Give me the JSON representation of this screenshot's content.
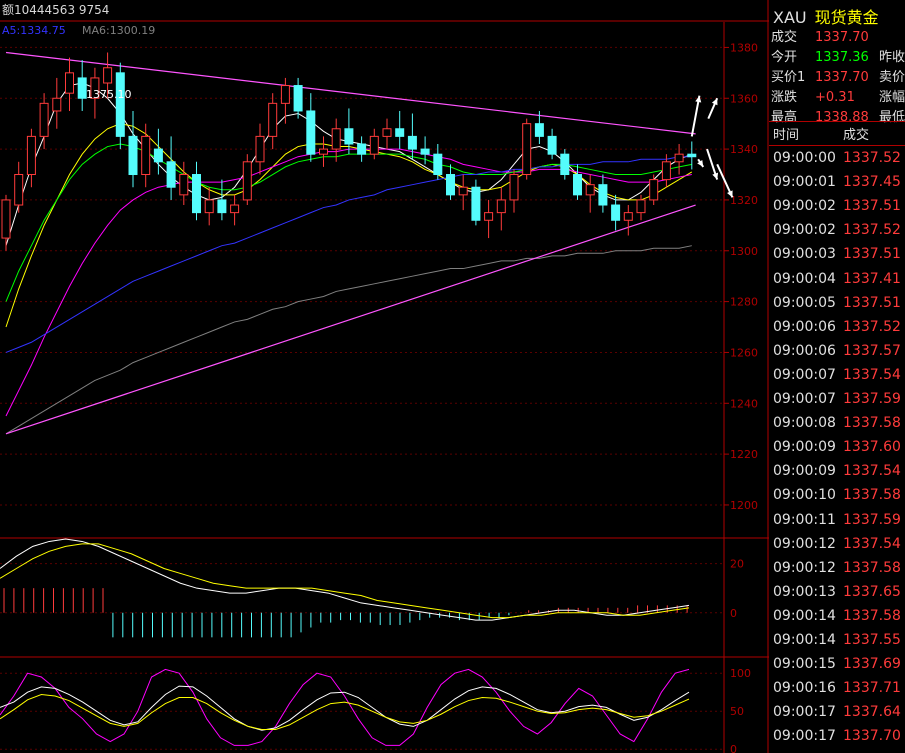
{
  "header": {
    "volume_text": "额10444563 9754",
    "ma5_label": "A5:1334.75",
    "ma6_label": "MA6:1300.19"
  },
  "colors": {
    "up": "#ff3b3b",
    "down": "#54fcfc",
    "border": "#b00000",
    "ma_white": "#ffffff",
    "ma_yellow": "#ffff00",
    "ma_magenta": "#ff00ff",
    "ma_green": "#00ff00",
    "ma_blue": "#3333ff",
    "ma_gray": "#808080",
    "trend": "#ff55ff",
    "arrow": "#ffffff"
  },
  "icons": [
    "up-arrow-icon",
    "down-arrow-icon"
  ],
  "chart_data": [
    {
      "type": "candlestick",
      "peak_label": "1375.10",
      "y_ticks": [
        1200,
        1220,
        1240,
        1260,
        1280,
        1300,
        1320,
        1340,
        1360,
        1380
      ],
      "ylim": [
        1187,
        1390
      ],
      "candles": [
        [
          1305,
          1322,
          1300,
          1320
        ],
        [
          1318,
          1335,
          1315,
          1330
        ],
        [
          1330,
          1348,
          1325,
          1345
        ],
        [
          1345,
          1362,
          1340,
          1358
        ],
        [
          1355,
          1368,
          1348,
          1360
        ],
        [
          1362,
          1376,
          1355,
          1370
        ],
        [
          1368,
          1375,
          1355,
          1360
        ],
        [
          1360,
          1372,
          1352,
          1368
        ],
        [
          1366,
          1378,
          1360,
          1372
        ],
        [
          1370,
          1374,
          1340,
          1345
        ],
        [
          1345,
          1355,
          1325,
          1330
        ],
        [
          1330,
          1350,
          1325,
          1345
        ],
        [
          1340,
          1348,
          1330,
          1335
        ],
        [
          1335,
          1345,
          1320,
          1325
        ],
        [
          1322,
          1335,
          1318,
          1330
        ],
        [
          1330,
          1335,
          1312,
          1315
        ],
        [
          1315,
          1325,
          1310,
          1320
        ],
        [
          1320,
          1328,
          1312,
          1315
        ],
        [
          1315,
          1322,
          1310,
          1318
        ],
        [
          1320,
          1338,
          1318,
          1335
        ],
        [
          1335,
          1350,
          1330,
          1345
        ],
        [
          1345,
          1362,
          1340,
          1358
        ],
        [
          1358,
          1368,
          1350,
          1365
        ],
        [
          1365,
          1368,
          1352,
          1355
        ],
        [
          1355,
          1362,
          1335,
          1338
        ],
        [
          1338,
          1345,
          1333,
          1340
        ],
        [
          1340,
          1352,
          1335,
          1348
        ],
        [
          1348,
          1356,
          1338,
          1342
        ],
        [
          1342,
          1345,
          1335,
          1338
        ],
        [
          1338,
          1348,
          1336,
          1345
        ],
        [
          1345,
          1352,
          1340,
          1348
        ],
        [
          1348,
          1355,
          1340,
          1345
        ],
        [
          1345,
          1354,
          1336,
          1340
        ],
        [
          1340,
          1345,
          1334,
          1338
        ],
        [
          1338,
          1342,
          1328,
          1330
        ],
        [
          1330,
          1334,
          1320,
          1322
        ],
        [
          1322,
          1330,
          1316,
          1325
        ],
        [
          1325,
          1328,
          1310,
          1312
        ],
        [
          1312,
          1320,
          1305,
          1315
        ],
        [
          1315,
          1325,
          1308,
          1320
        ],
        [
          1320,
          1332,
          1315,
          1330
        ],
        [
          1330,
          1352,
          1328,
          1350
        ],
        [
          1350,
          1355,
          1342,
          1345
        ],
        [
          1345,
          1348,
          1336,
          1338
        ],
        [
          1338,
          1340,
          1328,
          1330
        ],
        [
          1330,
          1334,
          1320,
          1322
        ],
        [
          1322,
          1330,
          1315,
          1326
        ],
        [
          1326,
          1330,
          1315,
          1318
        ],
        [
          1318,
          1322,
          1308,
          1312
        ],
        [
          1312,
          1318,
          1306,
          1315
        ],
        [
          1315,
          1322,
          1312,
          1320
        ],
        [
          1320,
          1330,
          1318,
          1328
        ],
        [
          1328,
          1338,
          1325,
          1335
        ],
        [
          1335,
          1342,
          1330,
          1338
        ],
        [
          1338,
          1343,
          1332,
          1337
        ]
      ],
      "ma_series": [
        {
          "color_key": "ma_white",
          "values": [
            1302,
            1318,
            1333,
            1345,
            1358,
            1365,
            1366,
            1364,
            1360,
            1354,
            1346,
            1340,
            1334,
            1329,
            1325,
            1322,
            1320,
            1321,
            1325,
            1332,
            1340,
            1348,
            1353,
            1354,
            1351,
            1347,
            1344,
            1343,
            1342,
            1341,
            1340,
            1339,
            1336,
            1333,
            1330,
            1327,
            1324,
            1323,
            1324,
            1328,
            1334,
            1340,
            1341,
            1339,
            1335,
            1330,
            1325,
            1322,
            1320,
            1320,
            1323,
            1328,
            1333,
            1336,
            1338
          ]
        },
        {
          "color_key": "ma_yellow",
          "values": [
            1270,
            1285,
            1298,
            1310,
            1320,
            1330,
            1338,
            1344,
            1348,
            1350,
            1349,
            1346,
            1341,
            1336,
            1331,
            1327,
            1324,
            1322,
            1322,
            1324,
            1328,
            1333,
            1338,
            1341,
            1342,
            1342,
            1341,
            1341,
            1340,
            1339,
            1338,
            1337,
            1335,
            1332,
            1330,
            1327,
            1325,
            1324,
            1324,
            1325,
            1328,
            1331,
            1333,
            1334,
            1333,
            1330,
            1326,
            1323,
            1321,
            1320,
            1320,
            1322,
            1325,
            1328,
            1331
          ]
        },
        {
          "color_key": "ma_magenta",
          "values": [
            1235,
            1245,
            1255,
            1266,
            1276,
            1286,
            1295,
            1303,
            1310,
            1316,
            1320,
            1323,
            1325,
            1326,
            1327,
            1327,
            1327,
            1327,
            1328,
            1329,
            1331,
            1333,
            1335,
            1337,
            1338,
            1339,
            1339,
            1340,
            1340,
            1340,
            1340,
            1340,
            1339,
            1338,
            1337,
            1336,
            1334,
            1333,
            1332,
            1331,
            1331,
            1331,
            1332,
            1332,
            1332,
            1331,
            1330,
            1329,
            1328,
            1327,
            1327,
            1327,
            1328,
            1329,
            1330
          ]
        },
        {
          "color_key": "ma_green",
          "values": [
            1280,
            1292,
            1302,
            1312,
            1320,
            1328,
            1334,
            1338,
            1341,
            1342,
            1341,
            1339,
            1336,
            1333,
            1330,
            1327,
            1325,
            1324,
            1324,
            1325,
            1327,
            1330,
            1333,
            1335,
            1336,
            1337,
            1337,
            1338,
            1338,
            1338,
            1338,
            1338,
            1337,
            1336,
            1334,
            1333,
            1331,
            1330,
            1330,
            1330,
            1331,
            1332,
            1333,
            1334,
            1334,
            1333,
            1332,
            1331,
            1330,
            1330,
            1330,
            1331,
            1332,
            1333,
            1334
          ]
        },
        {
          "color_key": "ma_blue",
          "values": [
            1260,
            1262,
            1264,
            1267,
            1270,
            1273,
            1276,
            1279,
            1282,
            1285,
            1288,
            1290,
            1292,
            1294,
            1296,
            1298,
            1300,
            1302,
            1303,
            1305,
            1307,
            1309,
            1311,
            1313,
            1315,
            1317,
            1318,
            1320,
            1321,
            1322,
            1324,
            1325,
            1326,
            1327,
            1328,
            1329,
            1330,
            1330,
            1331,
            1331,
            1332,
            1332,
            1333,
            1333,
            1334,
            1334,
            1334,
            1335,
            1335,
            1335,
            1336,
            1336,
            1336,
            1337,
            1337
          ]
        },
        {
          "color_key": "ma_gray",
          "values": [
            1228,
            1231,
            1234,
            1237,
            1240,
            1243,
            1246,
            1249,
            1251,
            1253,
            1256,
            1258,
            1260,
            1262,
            1264,
            1266,
            1268,
            1270,
            1272,
            1273,
            1275,
            1277,
            1278,
            1280,
            1281,
            1282,
            1284,
            1285,
            1286,
            1287,
            1288,
            1289,
            1290,
            1291,
            1292,
            1293,
            1293,
            1294,
            1295,
            1296,
            1296,
            1297,
            1297,
            1298,
            1298,
            1299,
            1299,
            1299,
            1300,
            1300,
            1300,
            1301,
            1301,
            1301,
            1302
          ]
        }
      ],
      "trend_upper": [
        [
          0,
          1378
        ],
        [
          54.3,
          1346
        ]
      ],
      "trend_lower": [
        [
          0,
          1228
        ],
        [
          54.3,
          1318
        ]
      ]
    },
    {
      "type": "bar",
      "name": "macd",
      "y_ticks": [
        0,
        20
      ],
      "ylim": [
        -18,
        30
      ],
      "histogram": [
        10,
        10,
        10,
        10,
        10,
        10,
        10,
        10,
        10,
        10,
        10,
        -10,
        -10,
        -10,
        -10,
        -10,
        -10,
        -10,
        -10,
        -10,
        -10,
        -10,
        -10,
        -10,
        -10,
        -10,
        -10,
        -10,
        -10,
        -10,
        -8,
        -6,
        -4,
        -4,
        -3,
        -3,
        -4,
        -4,
        -5,
        -5,
        -5,
        -4,
        -3,
        -2,
        -2,
        -2,
        -3,
        -3,
        -3,
        -2,
        -2,
        -1,
        0,
        1,
        1,
        1,
        2,
        2,
        2,
        2,
        2,
        2,
        2,
        2,
        3,
        3,
        3,
        3,
        3,
        3
      ],
      "dif": [
        18,
        23,
        27,
        29,
        30,
        29,
        27,
        24,
        21,
        18,
        15,
        12,
        10,
        9,
        8,
        8,
        9,
        10,
        10,
        9,
        8,
        6,
        4,
        3,
        2,
        1,
        0,
        -1,
        -2,
        -3,
        -3,
        -2,
        -1,
        0,
        1,
        1,
        0,
        -1,
        -1,
        0,
        1,
        2,
        3
      ],
      "dea": [
        14,
        18,
        22,
        25,
        27,
        28,
        28,
        26,
        24,
        21,
        18,
        16,
        14,
        12,
        11,
        10,
        10,
        10,
        10,
        10,
        9,
        8,
        7,
        5,
        4,
        3,
        2,
        1,
        0,
        -1,
        -2,
        -2,
        -1,
        -1,
        0,
        0,
        0,
        0,
        -1,
        -1,
        0,
        1,
        2
      ]
    },
    {
      "type": "line",
      "name": "kdj",
      "y_ticks": [
        0,
        50,
        100
      ],
      "ylim": [
        -5,
        120
      ],
      "k": [
        45,
        70,
        100,
        95,
        80,
        55,
        40,
        20,
        10,
        20,
        50,
        95,
        105,
        100,
        75,
        40,
        15,
        5,
        5,
        10,
        30,
        60,
        85,
        100,
        95,
        70,
        40,
        15,
        5,
        5,
        20,
        55,
        85,
        100,
        105,
        95,
        75,
        50,
        30,
        20,
        35,
        60,
        80,
        70,
        45,
        20,
        10,
        40,
        75,
        100,
        105
      ],
      "d": [
        55,
        62,
        75,
        82,
        80,
        72,
        62,
        50,
        38,
        32,
        36,
        55,
        72,
        83,
        82,
        70,
        55,
        40,
        30,
        25,
        28,
        38,
        52,
        65,
        74,
        75,
        68,
        55,
        42,
        33,
        30,
        38,
        52,
        66,
        77,
        82,
        80,
        72,
        62,
        52,
        48,
        50,
        56,
        58,
        55,
        46,
        38,
        42,
        52,
        64,
        75
      ],
      "j": [
        40,
        52,
        65,
        72,
        70,
        64,
        54,
        44,
        34,
        30,
        34,
        48,
        60,
        68,
        68,
        60,
        48,
        38,
        30,
        26,
        26,
        32,
        42,
        52,
        60,
        62,
        58,
        50,
        42,
        36,
        34,
        38,
        46,
        56,
        64,
        68,
        67,
        62,
        56,
        50,
        47,
        48,
        52,
        54,
        52,
        47,
        42,
        44,
        50,
        58,
        66
      ]
    }
  ],
  "quote": {
    "symbol_code": "XAU",
    "symbol_name": "现货黄金",
    "rows": [
      {
        "label": "成交",
        "value": "1337.70",
        "color": "#ff3b3b",
        "label2": ""
      },
      {
        "label": "今开",
        "value": "1337.36",
        "color": "#00ff00",
        "label2": "昨收"
      },
      {
        "label": "买价1",
        "value": "1337.70",
        "color": "#ff3b3b",
        "label2": "卖价"
      },
      {
        "label": "涨跌",
        "value": "+0.31",
        "color": "#ff3b3b",
        "label2": "涨幅"
      },
      {
        "label": "最高",
        "value": "1338.88",
        "color": "#ff3b3b",
        "label2": "最低"
      }
    ]
  },
  "ticks": {
    "time_header": "时间",
    "price_header": "成交",
    "rows": [
      {
        "time": "09:00:00",
        "price": "1337.52"
      },
      {
        "time": "09:00:01",
        "price": "1337.45"
      },
      {
        "time": "09:00:02",
        "price": "1337.51"
      },
      {
        "time": "09:00:02",
        "price": "1337.52"
      },
      {
        "time": "09:00:03",
        "price": "1337.51"
      },
      {
        "time": "09:00:04",
        "price": "1337.41"
      },
      {
        "time": "09:00:05",
        "price": "1337.51"
      },
      {
        "time": "09:00:06",
        "price": "1337.52"
      },
      {
        "time": "09:00:06",
        "price": "1337.57"
      },
      {
        "time": "09:00:07",
        "price": "1337.54"
      },
      {
        "time": "09:00:07",
        "price": "1337.59"
      },
      {
        "time": "09:00:08",
        "price": "1337.58"
      },
      {
        "time": "09:00:09",
        "price": "1337.60"
      },
      {
        "time": "09:00:09",
        "price": "1337.54"
      },
      {
        "time": "09:00:10",
        "price": "1337.58"
      },
      {
        "time": "09:00:11",
        "price": "1337.59"
      },
      {
        "time": "09:00:12",
        "price": "1337.54"
      },
      {
        "time": "09:00:12",
        "price": "1337.58"
      },
      {
        "time": "09:00:13",
        "price": "1337.65"
      },
      {
        "time": "09:00:14",
        "price": "1337.58"
      },
      {
        "time": "09:00:14",
        "price": "1337.55"
      },
      {
        "time": "09:00:15",
        "price": "1337.69"
      },
      {
        "time": "09:00:16",
        "price": "1337.71"
      },
      {
        "time": "09:00:17",
        "price": "1337.64"
      },
      {
        "time": "09:00:17",
        "price": "1337.70"
      }
    ]
  }
}
